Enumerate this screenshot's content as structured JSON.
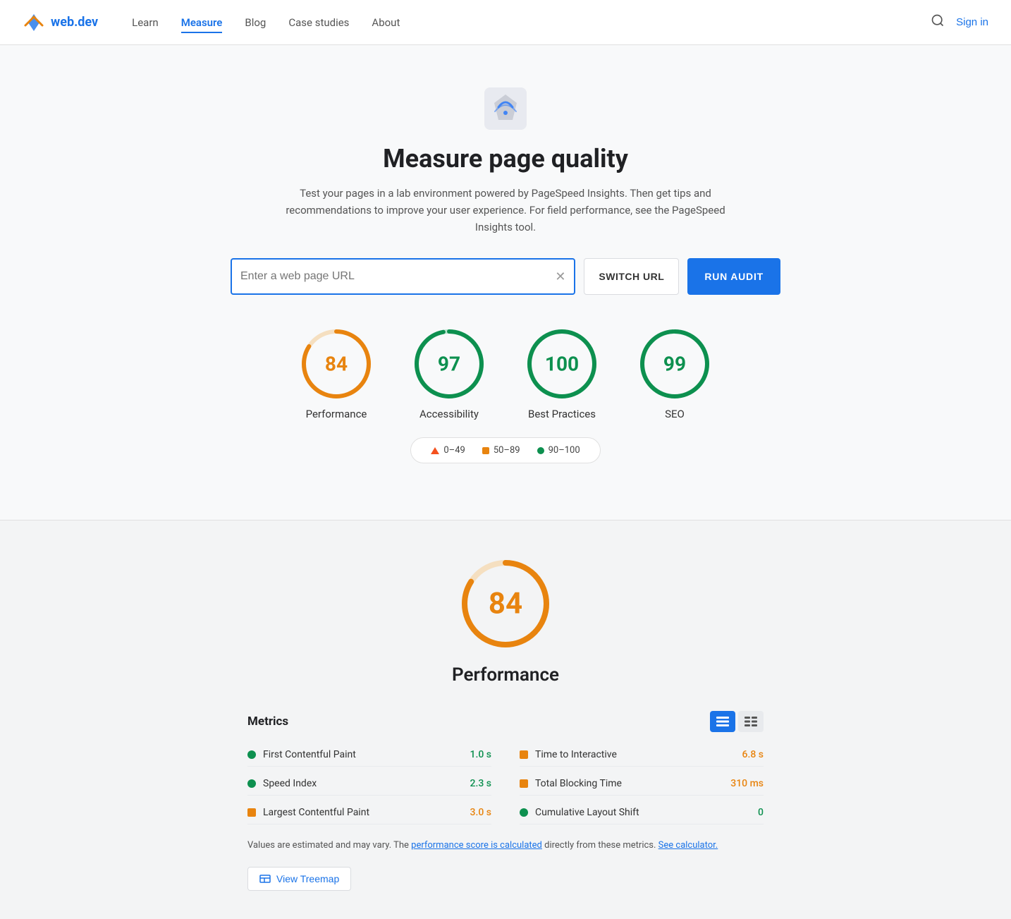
{
  "nav": {
    "logo_text": "web.dev",
    "links": [
      {
        "label": "Learn",
        "active": false
      },
      {
        "label": "Measure",
        "active": true
      },
      {
        "label": "Blog",
        "active": false
      },
      {
        "label": "Case studies",
        "active": false
      },
      {
        "label": "About",
        "active": false
      }
    ],
    "sign_in": "Sign in"
  },
  "hero": {
    "title": "Measure page quality",
    "description": "Test your pages in a lab environment powered by PageSpeed Insights. Then get tips and recommendations to improve your user experience. For field performance, see the PageSpeed Insights tool."
  },
  "url_input": {
    "placeholder": "Enter a web page URL",
    "value": "",
    "switch_url_label": "SWITCH URL",
    "run_audit_label": "RUN AUDIT"
  },
  "scores": [
    {
      "label": "Performance",
      "value": 84,
      "color": "#e8840f",
      "track_color": "#f5dfc0",
      "type": "orange"
    },
    {
      "label": "Accessibility",
      "value": 97,
      "color": "#0d904f",
      "track_color": "#b7e5ce",
      "type": "green"
    },
    {
      "label": "Best Practices",
      "value": 100,
      "color": "#0d904f",
      "track_color": "#b7e5ce",
      "type": "green"
    },
    {
      "label": "SEO",
      "value": 99,
      "color": "#0d904f",
      "track_color": "#b7e5ce",
      "type": "green"
    }
  ],
  "legend": [
    {
      "label": "0–49",
      "type": "triangle",
      "color": "#f4511e"
    },
    {
      "label": "50–89",
      "type": "square",
      "color": "#e8840f"
    },
    {
      "label": "90–100",
      "type": "dot",
      "color": "#0d904f"
    }
  ],
  "performance_section": {
    "score": 84,
    "title": "Performance",
    "metrics_title": "Metrics"
  },
  "metrics": {
    "left": [
      {
        "label": "First Contentful Paint",
        "value": "1.0 s",
        "color_class": "green",
        "indicator": "dot",
        "indicator_color": "#0d904f"
      },
      {
        "label": "Speed Index",
        "value": "2.3 s",
        "color_class": "green",
        "indicator": "dot",
        "indicator_color": "#0d904f"
      },
      {
        "label": "Largest Contentful Paint",
        "value": "3.0 s",
        "color_class": "orange",
        "indicator": "square",
        "indicator_color": "#e8840f"
      }
    ],
    "right": [
      {
        "label": "Time to Interactive",
        "value": "6.8 s",
        "color_class": "orange",
        "indicator": "square",
        "indicator_color": "#e8840f"
      },
      {
        "label": "Total Blocking Time",
        "value": "310 ms",
        "color_class": "orange",
        "indicator": "square",
        "indicator_color": "#e8840f"
      },
      {
        "label": "Cumulative Layout Shift",
        "value": "0",
        "color_class": "green",
        "indicator": "dot",
        "indicator_color": "#0d904f"
      }
    ]
  },
  "footnote": {
    "text_before": "Values are estimated and may vary. The ",
    "link1": "performance score is calculated",
    "text_middle": " directly from these metrics. ",
    "link2": "See calculator."
  },
  "treemap_button": "View Treemap"
}
